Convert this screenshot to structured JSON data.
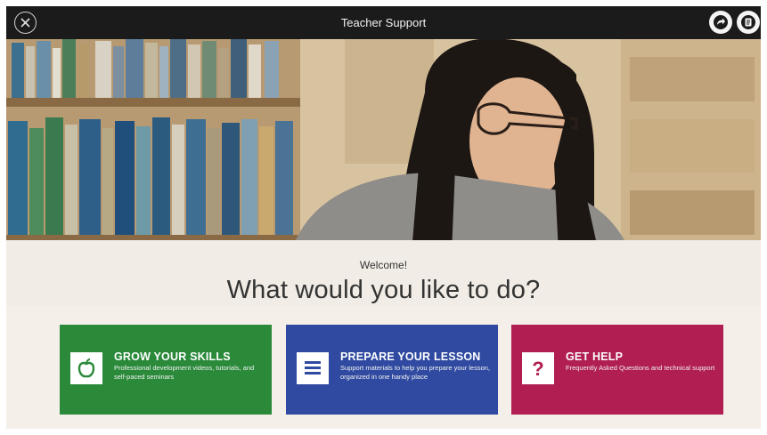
{
  "window": {
    "title": "Teacher Support"
  },
  "toolbar": {
    "close_icon": "close-circle-icon",
    "share_icon": "share-icon",
    "notes_icon": "notes-icon"
  },
  "main": {
    "welcome": "Welcome!",
    "headline": "What would you like to do?",
    "cards": [
      {
        "title": "GROW YOUR SKILLS",
        "description": "Professional development videos, tutorials, and self-paced seminars",
        "icon": "apple-icon",
        "color": "#2a8a3a"
      },
      {
        "title": "PREPARE YOUR LESSON",
        "description": "Support materials to help you prepare your lesson, organized in one handy place",
        "icon": "document-lines-icon",
        "color": "#2f4aa0"
      },
      {
        "title": "GET HELP",
        "description": "Frequently Asked Questions and technical support",
        "icon": "question-mark-icon",
        "color": "#b01e52"
      }
    ]
  }
}
